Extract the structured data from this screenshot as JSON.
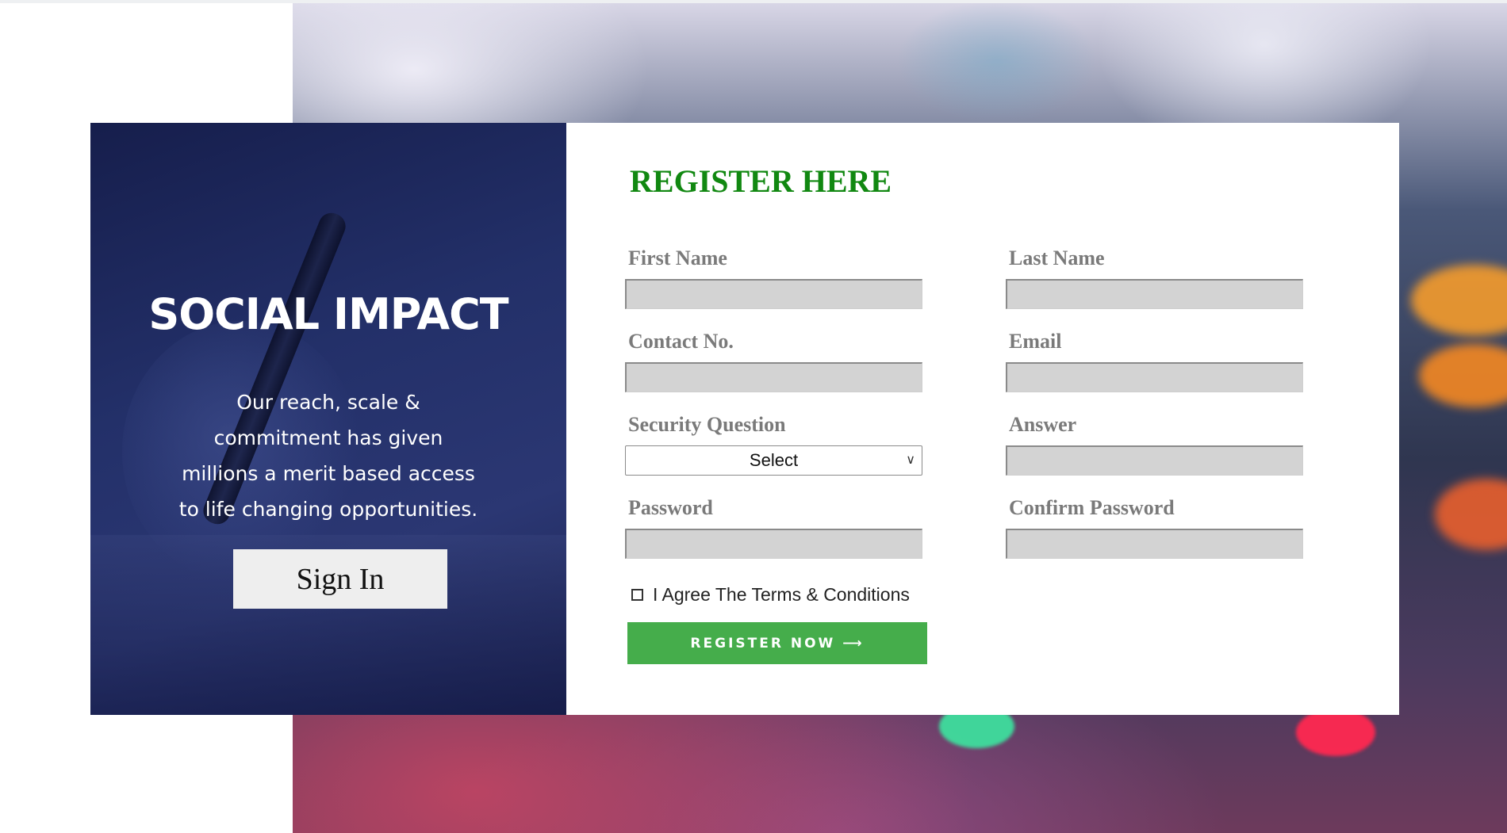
{
  "left_panel": {
    "title": "SOCIAL IMPACT",
    "description": "Our reach, scale & commitment has given millions a merit based access to life changing opportunities.",
    "signin_label": "Sign In"
  },
  "form": {
    "title": "REGISTER HERE",
    "fields": [
      {
        "label": "First Name",
        "value": ""
      },
      {
        "label": "Last Name",
        "value": ""
      },
      {
        "label": "Contact No.",
        "value": ""
      },
      {
        "label": "Email",
        "value": ""
      },
      {
        "label": "Security Question",
        "value": "Select"
      },
      {
        "label": "Answer",
        "value": ""
      },
      {
        "label": "Password",
        "value": ""
      },
      {
        "label": "Confirm Password",
        "value": ""
      }
    ],
    "agree_label": "I Agree The Terms & Conditions",
    "agree_checked": false,
    "register_label": "REGISTER NOW ⟶"
  },
  "colors": {
    "title_green": "#118811",
    "button_green": "#45ad4b",
    "panel_navy": "#233069",
    "input_gray": "#d3d3d3"
  }
}
